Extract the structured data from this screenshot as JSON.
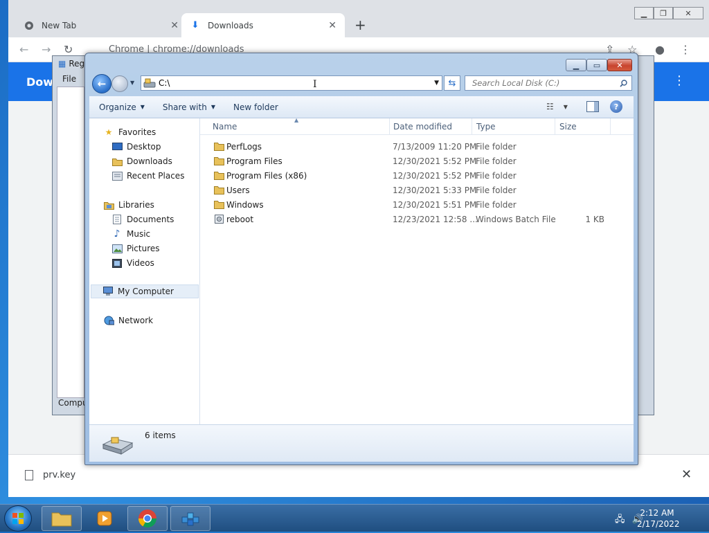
{
  "chrome": {
    "tabs": [
      {
        "label": "New Tab"
      },
      {
        "label": "Downloads"
      }
    ],
    "url_label": "Chrome  |  chrome://downloads",
    "page_title": "Down",
    "download_file": "prv.key"
  },
  "regedit": {
    "title": "Reg",
    "menu_file": "File",
    "status": "Compu"
  },
  "explorer": {
    "address": "C:\\",
    "search_placeholder": "Search Local Disk (C:)",
    "toolbar": {
      "organize": "Organize",
      "share_with": "Share with",
      "new_folder": "New folder"
    },
    "nav": {
      "favorites": "Favorites",
      "desktop": "Desktop",
      "downloads": "Downloads",
      "recent_places": "Recent Places",
      "libraries": "Libraries",
      "documents": "Documents",
      "music": "Music",
      "pictures": "Pictures",
      "videos": "Videos",
      "my_computer": "My Computer",
      "network": "Network"
    },
    "columns": {
      "name": "Name",
      "date_modified": "Date modified",
      "type": "Type",
      "size": "Size"
    },
    "files": [
      {
        "name": "PerfLogs",
        "date": "7/13/2009 11:20 PM",
        "type": "File folder",
        "size": "",
        "icon": "folder-icon"
      },
      {
        "name": "Program Files",
        "date": "12/30/2021 5:52 PM",
        "type": "File folder",
        "size": "",
        "icon": "folder-icon"
      },
      {
        "name": "Program Files (x86)",
        "date": "12/30/2021 5:52 PM",
        "type": "File folder",
        "size": "",
        "icon": "folder-icon"
      },
      {
        "name": "Users",
        "date": "12/30/2021 5:33 PM",
        "type": "File folder",
        "size": "",
        "icon": "folder-icon"
      },
      {
        "name": "Windows",
        "date": "12/30/2021 5:51 PM",
        "type": "File folder",
        "size": "",
        "icon": "folder-icon"
      },
      {
        "name": "reboot",
        "date": "12/23/2021 12:58 ...",
        "type": "Windows Batch File",
        "size": "1 KB",
        "icon": "batch-file-icon"
      }
    ],
    "status_text": "6 items"
  },
  "taskbar": {
    "time": "2:12 AM",
    "date": "2/17/2022"
  },
  "colors": {
    "chrome_blue": "#1a73e8",
    "folder_yellow": "#e8c15a",
    "explorer_frame": "#a6c3e4"
  }
}
